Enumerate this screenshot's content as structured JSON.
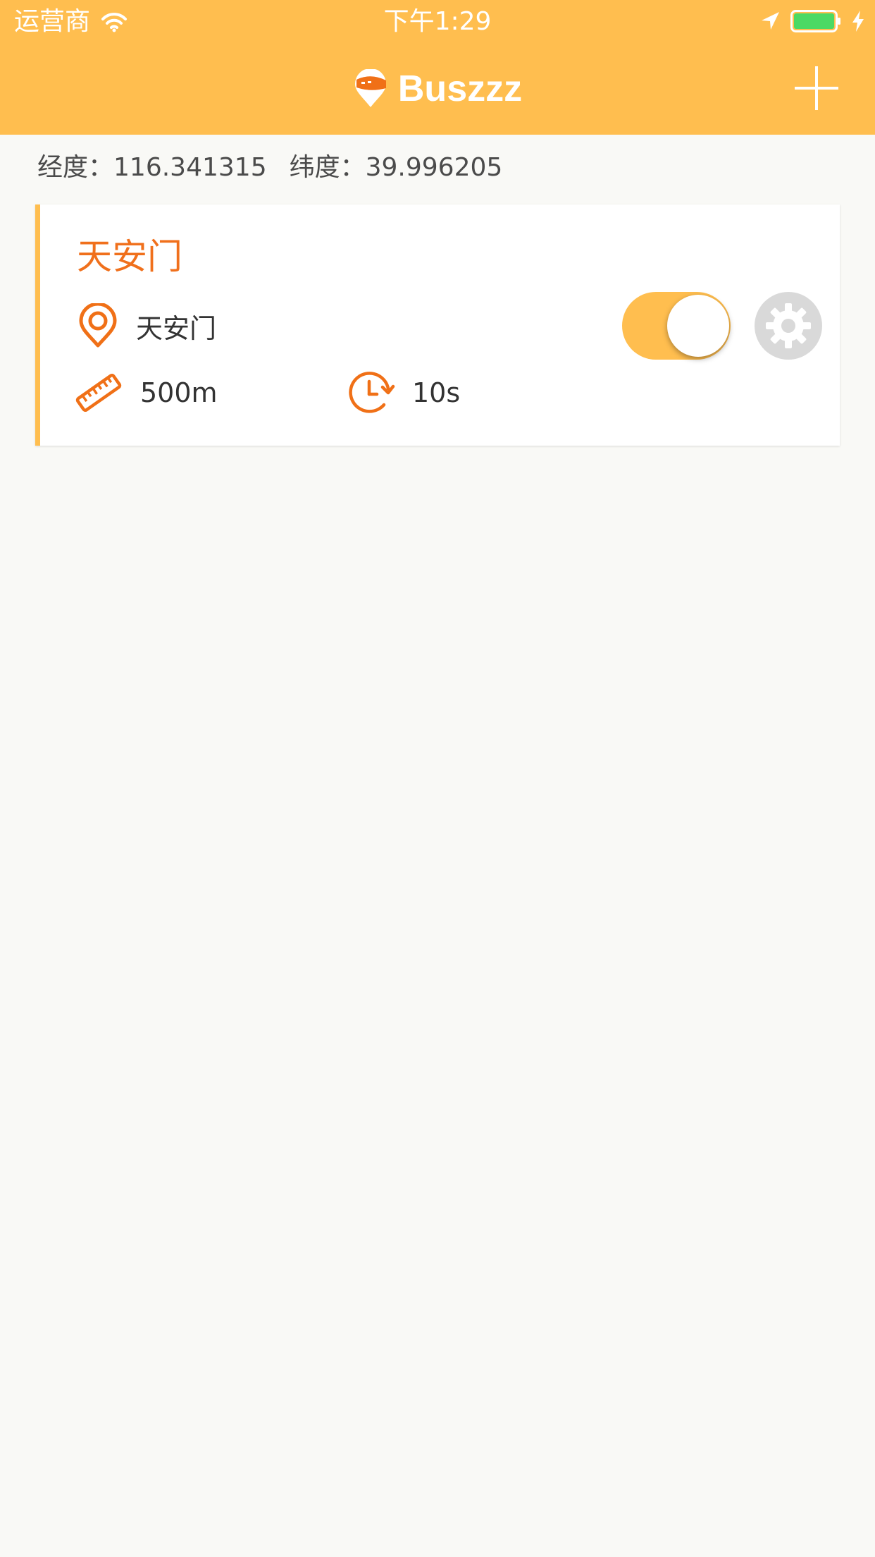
{
  "status_bar": {
    "carrier": "运营商",
    "time": "下午1:29",
    "icons": [
      "wifi-icon",
      "location-arrow-icon",
      "battery-icon",
      "charging-icon"
    ],
    "battery_color": "#4cd964"
  },
  "nav": {
    "title": "Buszzz",
    "logo_icon": "bus-pin-logo-icon",
    "add_icon": "plus-icon"
  },
  "location": {
    "lng_label": "经度：",
    "lng_value": "116.341315",
    "lat_label": "纬度：",
    "lat_value": "39.996205"
  },
  "reminders": [
    {
      "title": "天安门",
      "place": "天安门",
      "distance": "500m",
      "interval": "10s",
      "enabled": true
    }
  ],
  "colors": {
    "accent": "#ffbe4f",
    "title_orange": "#f0701c",
    "icon_orange": "#f07017",
    "background": "#f9f9f6",
    "gear_gray": "#d9d9d9"
  }
}
